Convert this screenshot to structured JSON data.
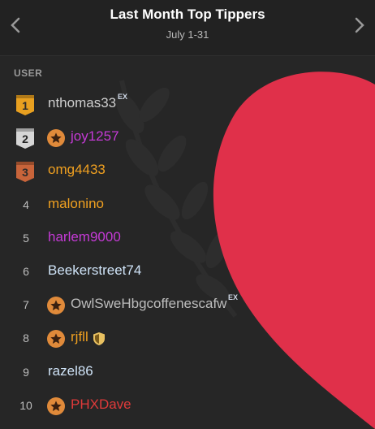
{
  "header": {
    "title": "Last Month Top Tippers",
    "subtitle": "July 1-31"
  },
  "table": {
    "column_user": "USER",
    "rows": [
      {
        "rank": "1",
        "name": "nthomas33",
        "color": "#cfcfcf",
        "badge": "gold",
        "star": false,
        "ex": "EX",
        "shield": false
      },
      {
        "rank": "2",
        "name": "joy1257",
        "color": "#c53ad6",
        "badge": "silver",
        "star": true,
        "ex": "",
        "shield": false
      },
      {
        "rank": "3",
        "name": "omg4433",
        "color": "#f0a020",
        "badge": "bronze",
        "star": false,
        "ex": "",
        "shield": false
      },
      {
        "rank": "4",
        "name": "malonino",
        "color": "#f0a020",
        "badge": "",
        "star": false,
        "ex": "",
        "shield": false
      },
      {
        "rank": "5",
        "name": "harlem9000",
        "color": "#c53ad6",
        "badge": "",
        "star": false,
        "ex": "",
        "shield": false
      },
      {
        "rank": "6",
        "name": "Beekerstreet74",
        "color": "#cfe3f7",
        "badge": "",
        "star": false,
        "ex": "",
        "shield": false
      },
      {
        "rank": "7",
        "name": "OwlSweHbgcoffenescafw",
        "color": "#bdbdbd",
        "badge": "",
        "star": true,
        "ex": "EX",
        "shield": false
      },
      {
        "rank": "8",
        "name": "rjfll",
        "color": "#f0a020",
        "badge": "",
        "star": true,
        "ex": "",
        "shield": true
      },
      {
        "rank": "9",
        "name": "razel86",
        "color": "#cfe3f7",
        "badge": "",
        "star": false,
        "ex": "",
        "shield": false
      },
      {
        "rank": "10",
        "name": "PHXDave",
        "color": "#e03a3a",
        "badge": "",
        "star": true,
        "ex": "",
        "shield": false
      }
    ]
  },
  "colors": {
    "accent_heart": "#e0304a",
    "star_badge": "#e08a3a",
    "gold": "#e8a020",
    "silver": "#d6d6d6",
    "bronze": "#c8643a"
  },
  "icons": {
    "prev": "chevron-left-icon",
    "next": "chevron-right-icon",
    "star": "star-icon",
    "shield": "shield-icon"
  }
}
